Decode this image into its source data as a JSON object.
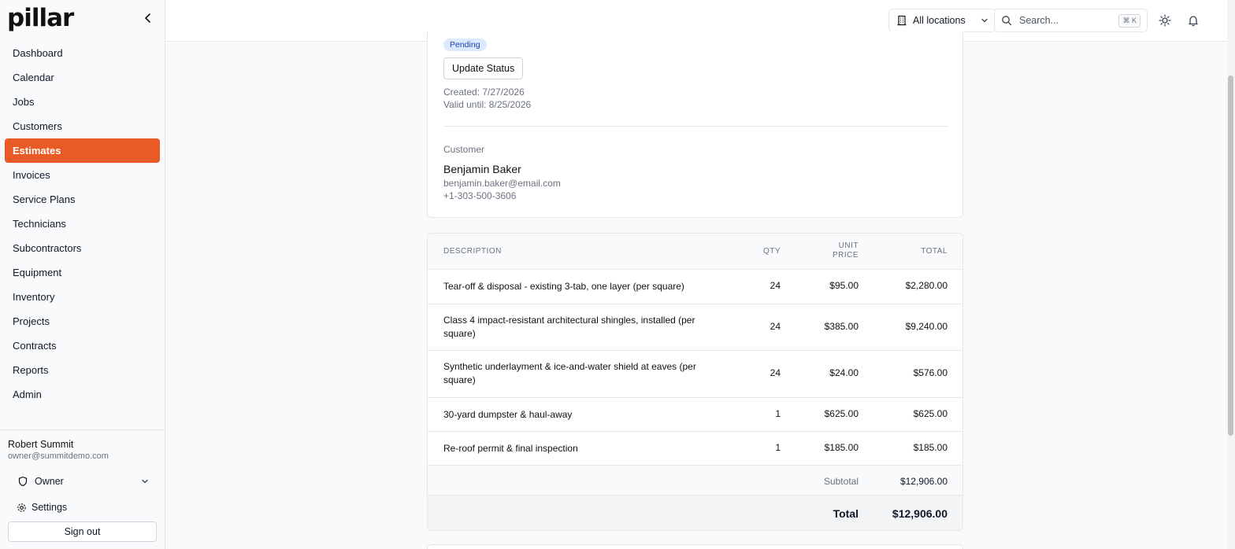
{
  "app": {
    "logo": "pillar"
  },
  "sidebar": {
    "items": [
      {
        "label": "Dashboard"
      },
      {
        "label": "Calendar"
      },
      {
        "label": "Jobs"
      },
      {
        "label": "Customers"
      },
      {
        "label": "Estimates",
        "active": true
      },
      {
        "label": "Invoices"
      },
      {
        "label": "Service Plans"
      },
      {
        "label": "Technicians"
      },
      {
        "label": "Subcontractors"
      },
      {
        "label": "Equipment"
      },
      {
        "label": "Inventory"
      },
      {
        "label": "Projects"
      },
      {
        "label": "Contracts"
      },
      {
        "label": "Reports"
      },
      {
        "label": "Admin"
      }
    ],
    "user": {
      "name": "Robert Summit",
      "email": "owner@summitdemo.com",
      "role": "Owner"
    },
    "settings_label": "Settings",
    "signout_label": "Sign out"
  },
  "topbar": {
    "location_label": "All locations",
    "search_placeholder": "Search...",
    "search_shortcut": "⌘ K"
  },
  "estimate": {
    "status": "Pending",
    "update_status_label": "Update Status",
    "created": "Created: 7/27/2026",
    "valid_until": "Valid until: 8/25/2026",
    "customer_label": "Customer",
    "customer": {
      "name": "Benjamin Baker",
      "email": "benjamin.baker@email.com",
      "phone": "+1-303-500-3606"
    }
  },
  "line_items": {
    "headers": {
      "description": "DESCRIPTION",
      "qty": "QTY",
      "unit_price_1": "UNIT",
      "unit_price_2": "PRICE",
      "total": "TOTAL"
    },
    "rows": [
      {
        "description": "Tear-off & disposal - existing 3-tab, one layer (per square)",
        "qty": "24",
        "unit_price": "$95.00",
        "total": "$2,280.00"
      },
      {
        "description": "Class 4 impact-resistant architectural shingles, installed (per square)",
        "qty": "24",
        "unit_price": "$385.00",
        "total": "$9,240.00"
      },
      {
        "description": "Synthetic underlayment & ice-and-water shield at eaves (per square)",
        "qty": "24",
        "unit_price": "$24.00",
        "total": "$576.00"
      },
      {
        "description": "30-yard dumpster & haul-away",
        "qty": "1",
        "unit_price": "$625.00",
        "total": "$625.00"
      },
      {
        "description": "Re-roof permit & final inspection",
        "qty": "1",
        "unit_price": "$185.00",
        "total": "$185.00"
      }
    ],
    "subtotal_label": "Subtotal",
    "subtotal": "$12,906.00",
    "total_label": "Total",
    "total": "$12,906.00"
  },
  "colors": {
    "accent": "#e85a26",
    "badge_bg": "#dbeafe",
    "badge_text": "#1e40af"
  }
}
